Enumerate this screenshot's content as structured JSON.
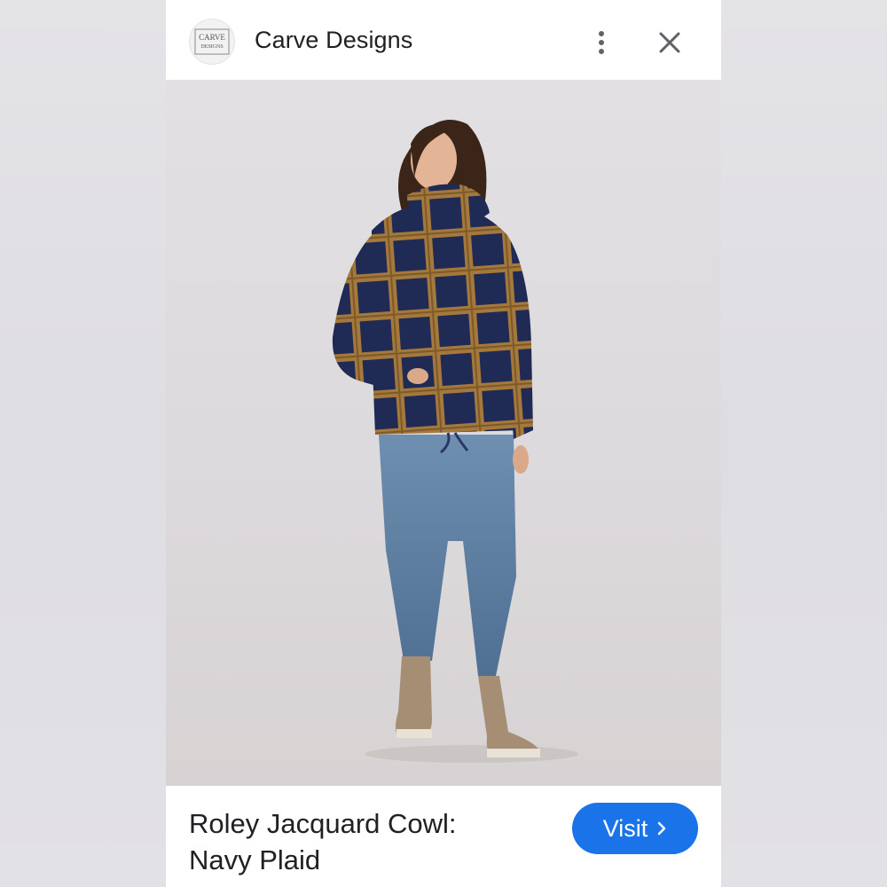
{
  "header": {
    "site_name": "Carve Designs",
    "logo_text": "CARVE DESIGNS"
  },
  "product": {
    "title_line1": "Roley Jacquard Cowl:",
    "title_line2": "Navy Plaid"
  },
  "actions": {
    "visit_label": "Visit",
    "visit_icon": "chevron-right-icon",
    "more_icon": "more-vert-icon",
    "close_icon": "close-icon"
  },
  "colors": {
    "accent": "#1a73e8",
    "text": "#202124",
    "icon": "#5f6368"
  }
}
